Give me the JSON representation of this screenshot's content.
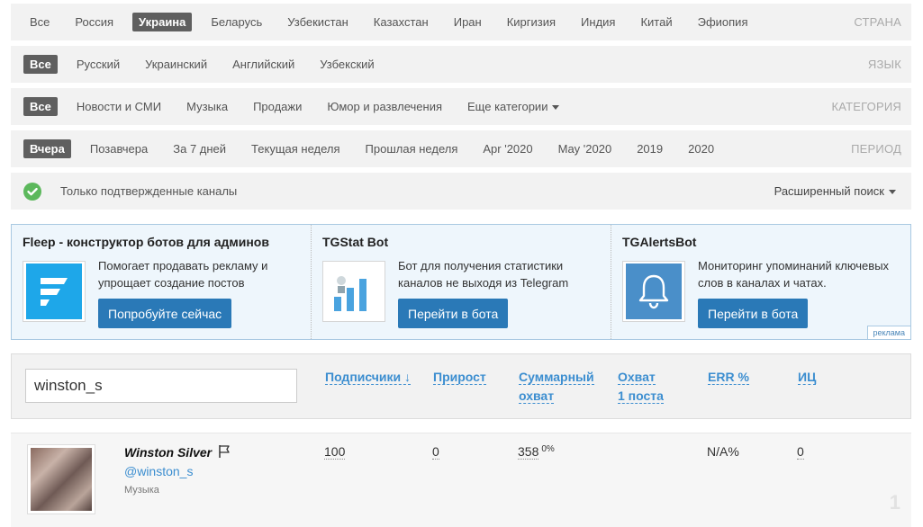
{
  "filters": {
    "country": {
      "label": "СТРАНА",
      "items": [
        "Все",
        "Россия",
        "Украина",
        "Беларусь",
        "Узбекистан",
        "Казахстан",
        "Иран",
        "Киргизия",
        "Индия",
        "Китай",
        "Эфиопия"
      ],
      "active": "Украина"
    },
    "language": {
      "label": "ЯЗЫК",
      "items": [
        "Все",
        "Русский",
        "Украинский",
        "Английский",
        "Узбекский"
      ],
      "active": "Все"
    },
    "category": {
      "label": "КАТЕГОРИЯ",
      "items": [
        "Все",
        "Новости и СМИ",
        "Музыка",
        "Продажи",
        "Юмор и развлечения",
        "Еще категории"
      ],
      "active": "Все"
    },
    "period": {
      "label": "ПЕРИОД",
      "items": [
        "Вчера",
        "Позавчера",
        "За 7 дней",
        "Текущая неделя",
        "Прошлая неделя",
        "Apr '2020",
        "May '2020",
        "2019",
        "2020"
      ],
      "active": "Вчера"
    },
    "verified_text": "Только подтвержденные каналы",
    "advanced_search": "Расширенный поиск"
  },
  "ads": {
    "label": "реклама",
    "items": [
      {
        "title": "Fleep - конструктор ботов для админов",
        "description": "Помогает продавать рекламу и упрощает создание постов",
        "button": "Попробуйте сейчас",
        "icon": "fleep-logo-icon"
      },
      {
        "title": "TGStat Bot",
        "description": "Бот для получения статистики каналов не выходя из Telegram",
        "button": "Перейти в бота",
        "icon": "tgstat-bot-icon"
      },
      {
        "title": "TGAlertsBot",
        "description": "Мониторинг упоминаний ключевых слов в каналах и чатах.",
        "button": "Перейти в бота",
        "icon": "bell-icon"
      }
    ]
  },
  "search": {
    "value": "winston_s"
  },
  "columns": {
    "subscribers": "Подписчики ↓",
    "growth": "Прирост",
    "total_reach_1": "Суммарный",
    "total_reach_2": "охват",
    "post_reach_1": "Охват",
    "post_reach_2": "1 поста",
    "err": "ERR %",
    "ic": "ИЦ"
  },
  "channel": {
    "name": "Winston Silver",
    "handle": "@winston_s",
    "category": "Музыка",
    "subscribers": "100",
    "growth": "0",
    "total_reach": "358",
    "total_reach_pct": "0%",
    "err": "N/A%",
    "ic": "0"
  },
  "page_number": "1",
  "colors": {
    "accent": "#2a79b7",
    "link": "#3c8ed0",
    "active_pill": "#5f5f5f",
    "verified": "#5cb85c"
  }
}
